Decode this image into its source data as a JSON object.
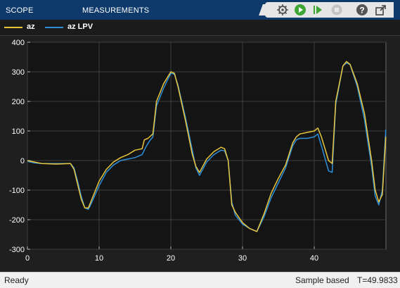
{
  "toolstrip": {
    "tabs": [
      "SCOPE",
      "MEASUREMENTS"
    ],
    "icons": [
      "scope-settings-icon",
      "run-icon",
      "step-forward-icon",
      "stop-icon",
      "help-icon",
      "undock-icon"
    ]
  },
  "colors": {
    "az": "#e8c53c",
    "az_lpv": "#2e8fd9",
    "background": "#141414",
    "grid": "#3e3e3e",
    "tick_text": "#ffffff",
    "toolbar": "#0d3a6b"
  },
  "chart_data": {
    "type": "line",
    "xlim": [
      0,
      50
    ],
    "ylim": [
      -300,
      400
    ],
    "xticks": [
      0,
      10,
      20,
      30,
      40
    ],
    "yticks": [
      -300,
      -200,
      -100,
      0,
      100,
      200,
      300,
      400
    ],
    "grid": true,
    "legend_position": "top",
    "series": [
      {
        "name": "az",
        "x": [
          0,
          1,
          2,
          4,
          6,
          6.5,
          7,
          7.5,
          8,
          8.5,
          9,
          10,
          11,
          12,
          13,
          14,
          15,
          16,
          16.3,
          16.8,
          17.5,
          18,
          19,
          20,
          20.5,
          21,
          22,
          23,
          23.5,
          24,
          25,
          26,
          27,
          27.5,
          28,
          28.5,
          29,
          30,
          31,
          32,
          33,
          34,
          35,
          36,
          37,
          37.5,
          38,
          39,
          40,
          40.5,
          41,
          42,
          42.5,
          43,
          44,
          44.5,
          45,
          46,
          47,
          48,
          48.5,
          49,
          49.5,
          49.98
        ],
        "y": [
          0,
          -5,
          -10,
          -12,
          -10,
          -30,
          -80,
          -130,
          -160,
          -160,
          -130,
          -70,
          -30,
          -5,
          10,
          20,
          35,
          40,
          70,
          75,
          90,
          200,
          260,
          300,
          295,
          250,
          140,
          20,
          -20,
          -40,
          5,
          30,
          45,
          40,
          0,
          -150,
          -175,
          -210,
          -230,
          -240,
          -180,
          -110,
          -60,
          -15,
          60,
          80,
          90,
          95,
          100,
          110,
          80,
          0,
          -10,
          200,
          320,
          335,
          325,
          260,
          160,
          0,
          -100,
          -140,
          -115,
          80
        ]
      },
      {
        "name": "az LPV",
        "x": [
          0,
          1,
          2,
          4,
          6,
          6.5,
          7,
          7.5,
          8,
          8.5,
          9,
          10,
          11,
          12,
          13,
          14,
          15,
          16,
          16.5,
          17,
          17.5,
          18,
          19,
          20,
          20.5,
          21,
          22,
          23,
          23.5,
          24,
          25,
          26,
          27,
          27.5,
          28,
          28.5,
          29,
          30,
          31,
          32,
          33,
          34,
          35,
          36,
          37,
          37.5,
          38,
          39,
          40,
          40.5,
          41,
          42,
          42.5,
          43,
          44,
          44.5,
          45,
          46,
          47,
          48,
          48.5,
          49,
          49.5,
          49.98
        ],
        "y": [
          -3,
          -8,
          -10,
          -10,
          -10,
          -25,
          -70,
          -120,
          -160,
          -165,
          -140,
          -85,
          -40,
          -15,
          0,
          5,
          10,
          20,
          45,
          65,
          80,
          185,
          245,
          295,
          292,
          255,
          150,
          35,
          -25,
          -50,
          -5,
          20,
          35,
          33,
          0,
          -140,
          -185,
          -215,
          -230,
          -240,
          -190,
          -125,
          -75,
          -25,
          50,
          70,
          75,
          75,
          80,
          90,
          50,
          -35,
          -40,
          190,
          320,
          330,
          325,
          250,
          140,
          -20,
          -120,
          -150,
          -100,
          105
        ]
      }
    ]
  },
  "status": {
    "ready": "Ready",
    "mode": "Sample based",
    "time": "T=49.9833"
  }
}
